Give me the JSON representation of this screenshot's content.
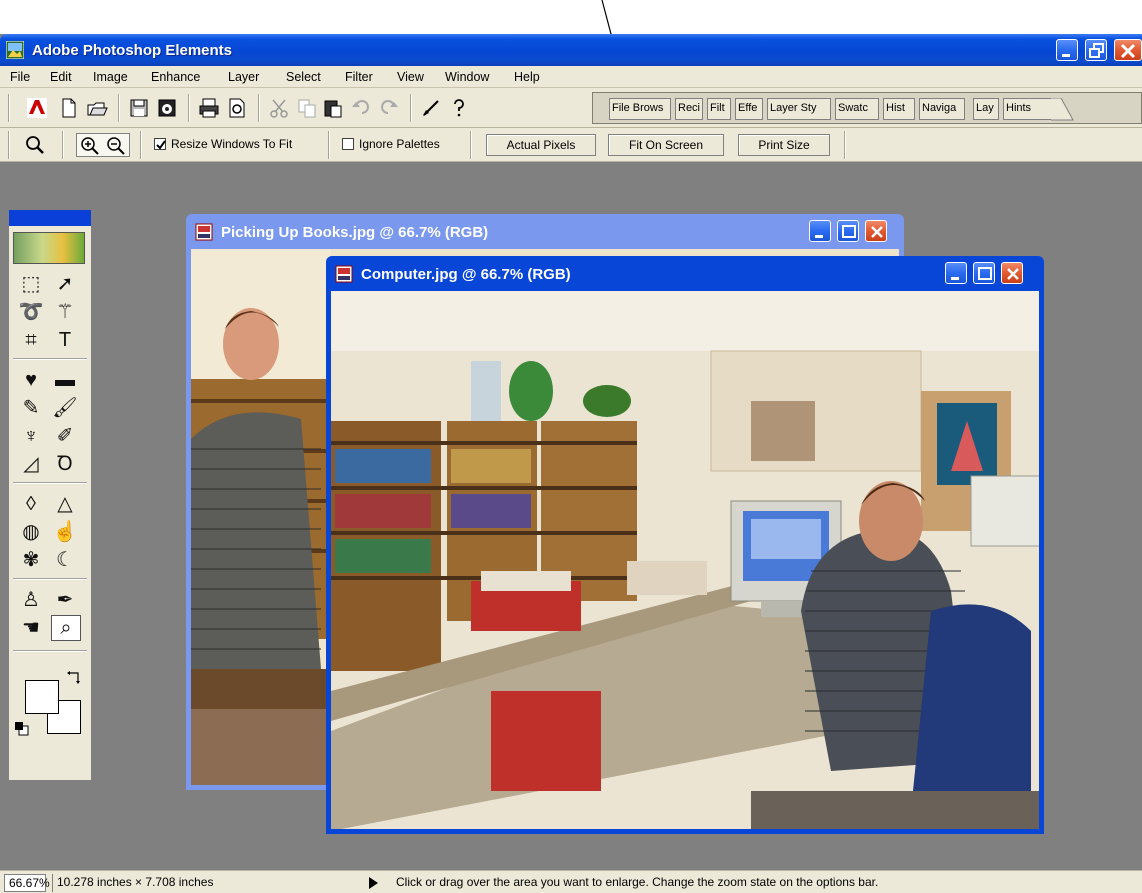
{
  "app": {
    "title": "Adobe Photoshop Elements"
  },
  "menubar": {
    "items": [
      "File",
      "Edit",
      "Image",
      "Enhance",
      "Layer",
      "Select",
      "Filter",
      "View",
      "Window",
      "Help"
    ]
  },
  "palette_well": {
    "tabs": [
      "File Brows",
      "Reci",
      "Filt",
      "Effe",
      "Layer Sty",
      "Swatc",
      "Hist",
      "Naviga",
      "Lay",
      "Hints"
    ]
  },
  "options_bar": {
    "resize_windows_label": "Resize Windows To Fit",
    "resize_windows_checked": true,
    "ignore_palettes_label": "Ignore Palettes",
    "ignore_palettes_checked": false,
    "actual_pixels_label": "Actual Pixels",
    "fit_on_screen_label": "Fit On Screen",
    "print_size_label": "Print Size"
  },
  "documents": {
    "back_title": "Picking Up Books.jpg @ 66.7% (RGB)",
    "front_title": "Computer.jpg @ 66.7% (RGB)"
  },
  "status": {
    "zoom": "66.67%",
    "dimensions": "10.278 inches × 7.708 inches",
    "hint": "Click or drag over the area you want to enlarge. Change the zoom state on the options bar."
  },
  "colors": {
    "titlebar": "#0a52e0",
    "workspace": "#808080",
    "chrome": "#ece9d8"
  }
}
